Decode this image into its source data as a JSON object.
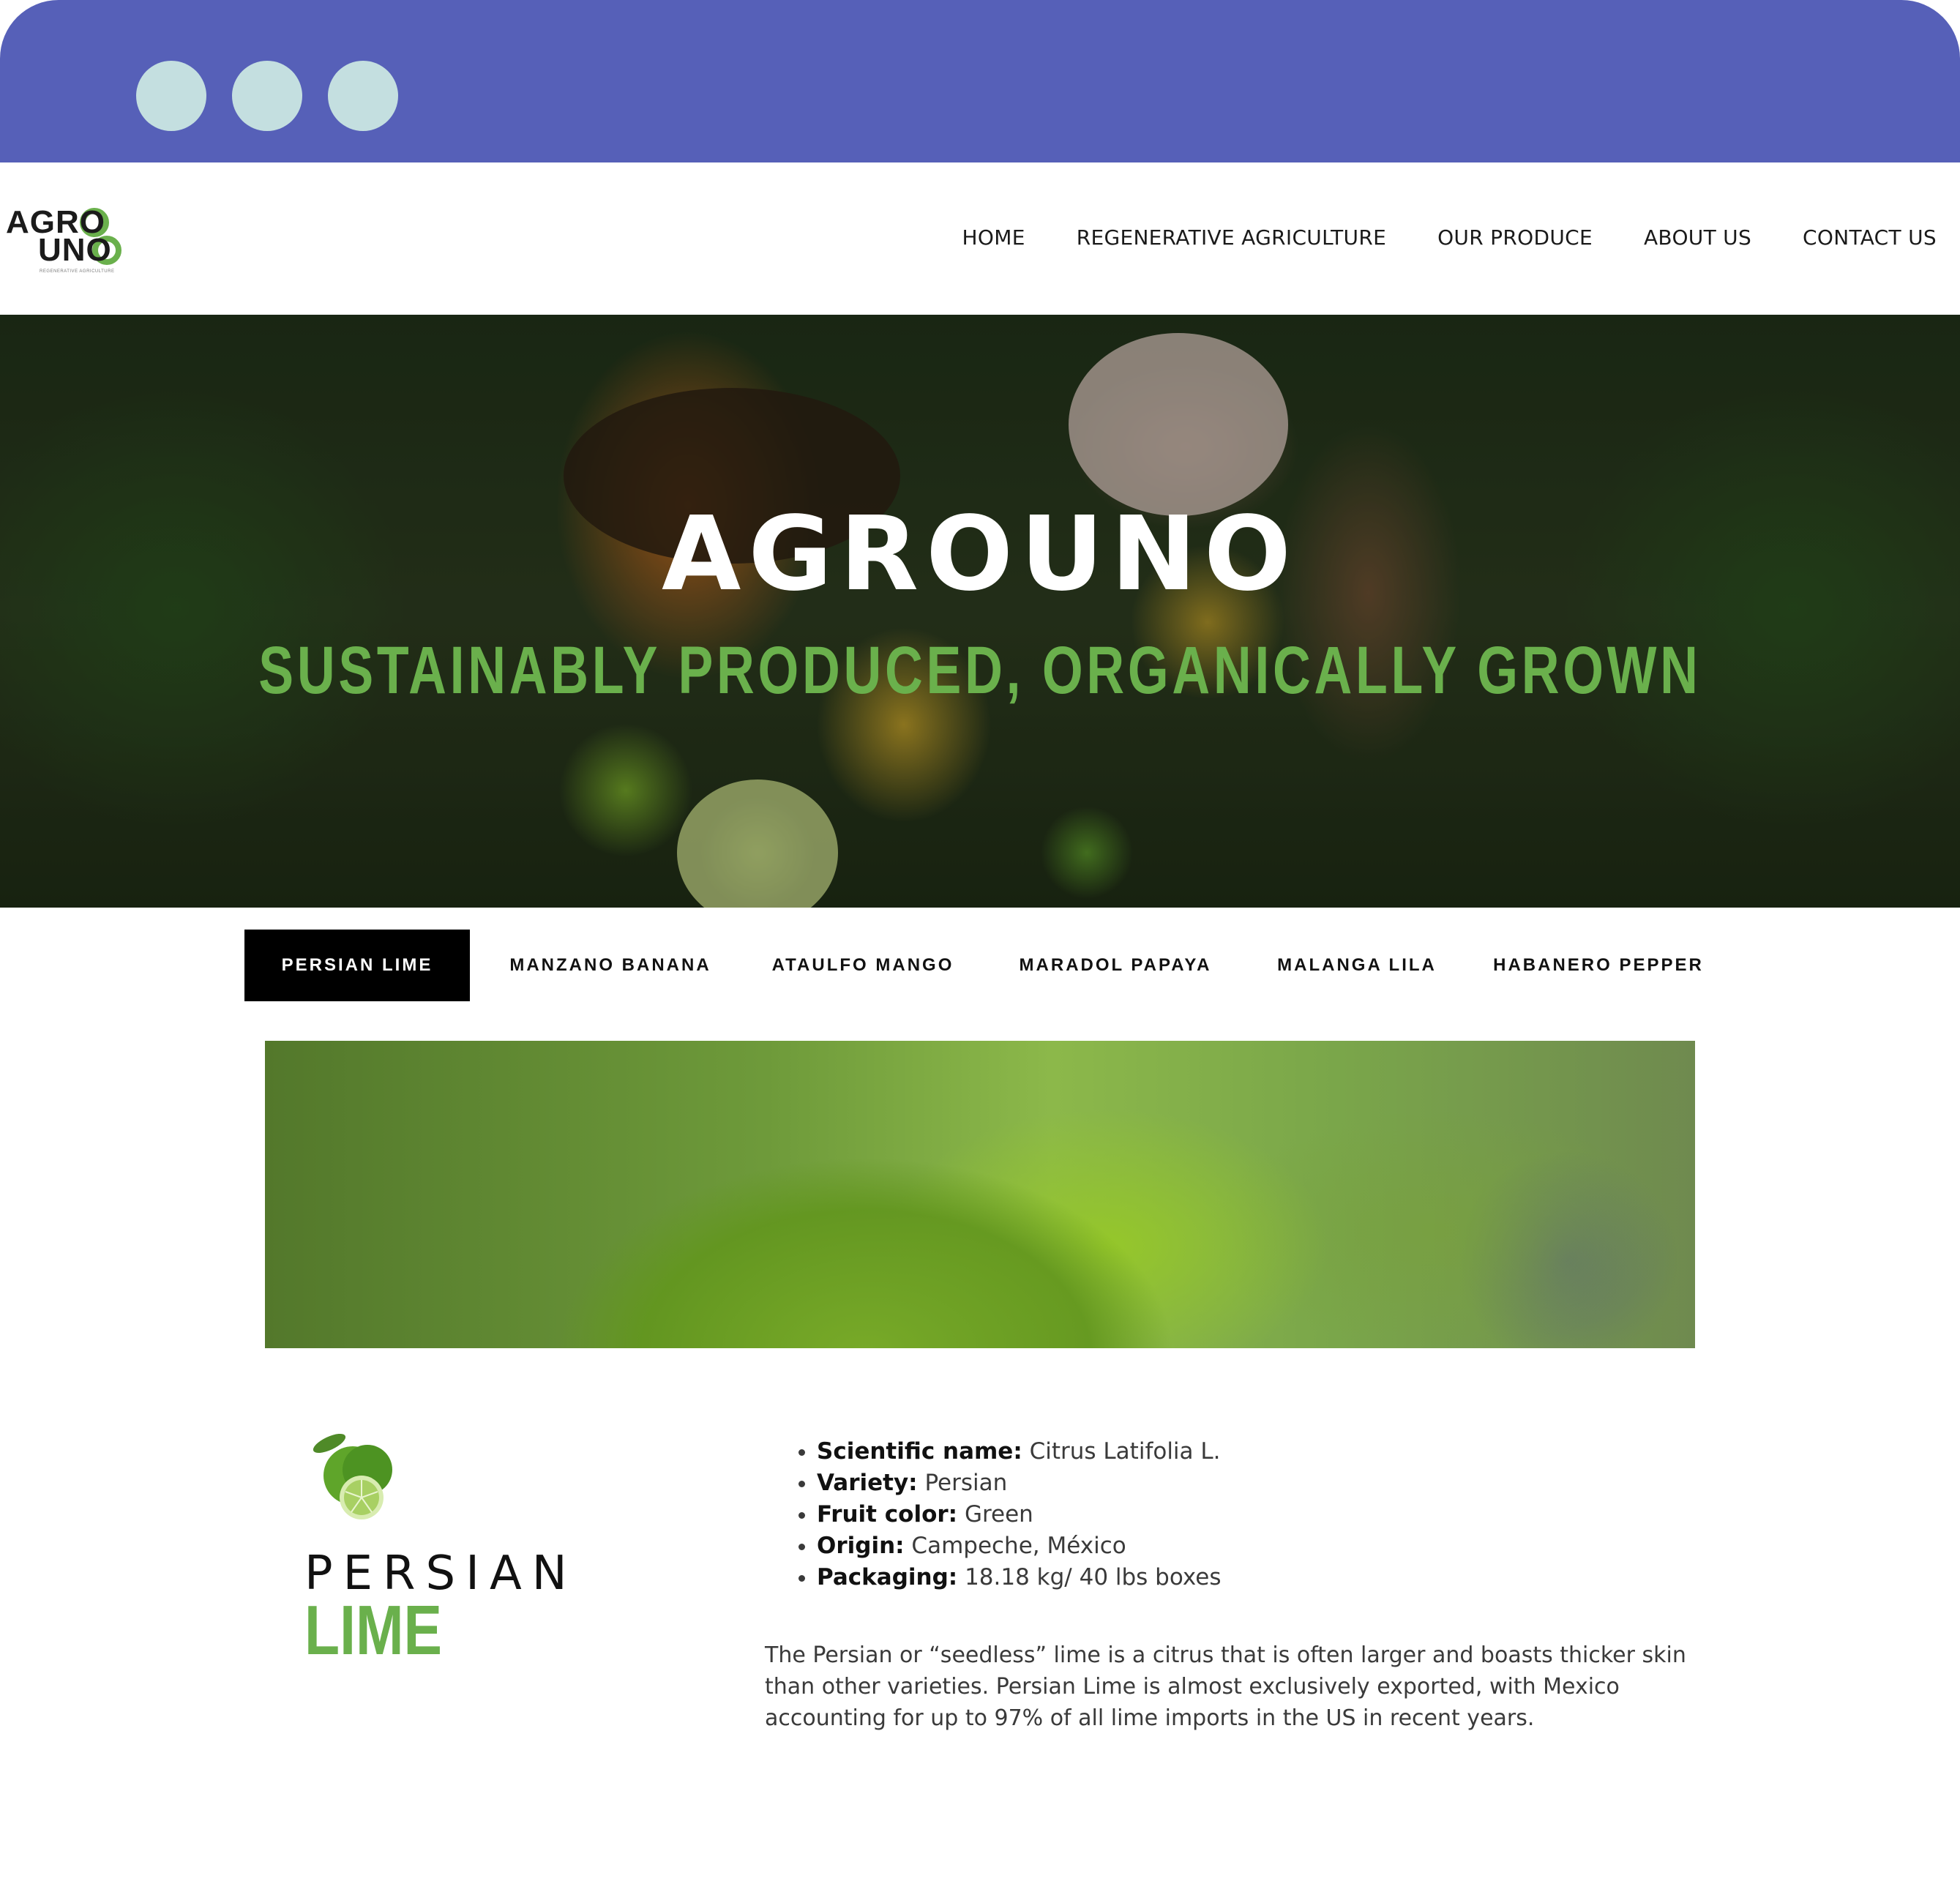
{
  "logo": {
    "line1": "AGRO",
    "line2": "UNO",
    "tagline": "REGENERATIVE AGRICULTURE",
    "accent": "#6ab04c"
  },
  "nav": {
    "items": [
      "HOME",
      "REGENERATIVE AGRICULTURE",
      "OUR PRODUCE",
      "ABOUT US",
      "CONTACT US"
    ]
  },
  "hero": {
    "title": "AGROUNO",
    "subtitle": "SUSTAINABLY PRODUCED, ORGANICALLY GROWN"
  },
  "tabs": {
    "items": [
      "PERSIAN LIME",
      "MANZANO BANANA",
      "ATAULFO MANGO",
      "MARADOL PAPAYA",
      "MALANGA LILA",
      "HABANERO PEPPER"
    ],
    "active": "PERSIAN LIME"
  },
  "product": {
    "name_top": "PERSIAN",
    "name_bottom": "LIME",
    "specs": [
      {
        "label": "Scientific name:",
        "value": "Citrus Latifolia L."
      },
      {
        "label": "Variety:",
        "value": "Persian"
      },
      {
        "label": "Fruit color:",
        "value": "Green"
      },
      {
        "label": "Origin:",
        "value": "Campeche, México"
      },
      {
        "label": "Packaging:",
        "value": "18.18 kg/ 40 lbs boxes"
      }
    ],
    "description": "The Persian or “seedless” lime is a citrus that is often larger and boasts thicker skin than other varieties. Persian Lime is almost exclusively exported, with Mexico accounting for up to 97% of all lime imports in the US in recent years."
  },
  "colors": {
    "chrome": "#5660b8",
    "chrome_dots": "#c4dfe0",
    "accent_green": "#6ab04c",
    "tab_active_bg": "#000000"
  }
}
